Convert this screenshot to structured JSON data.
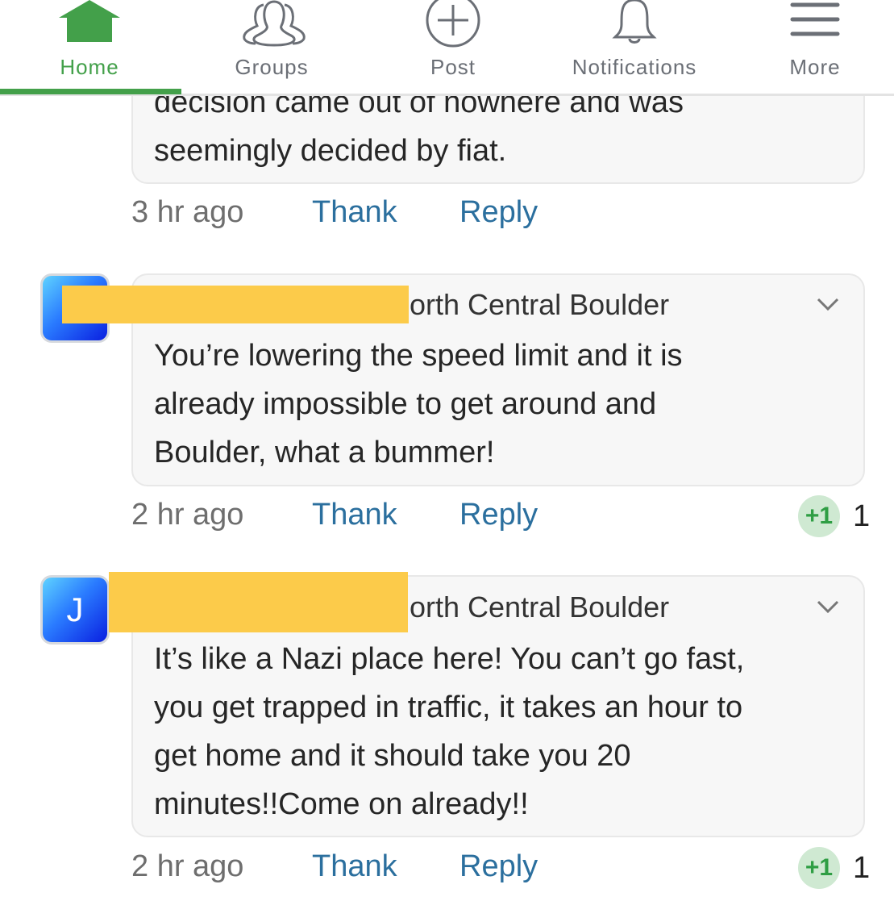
{
  "nav": {
    "tabs": [
      {
        "label": "Home",
        "icon": "home-icon",
        "active": true
      },
      {
        "label": "Groups",
        "icon": "groups-icon"
      },
      {
        "label": "Post",
        "icon": "plus-circle-icon"
      },
      {
        "label": "Notifications",
        "icon": "bell-icon"
      },
      {
        "label": "More",
        "icon": "menu-icon"
      }
    ],
    "active_color": "#43a04a"
  },
  "comments": [
    {
      "lines": [
        "decision came out of nowhere and was",
        "seemingly decided by fiat."
      ],
      "time": "3 hr ago",
      "thank": "Thank",
      "reply": "Reply"
    },
    {
      "avatar": "",
      "name_suffix": "orth Central Boulder",
      "lines": [
        "You’re lowering the speed limit and it is",
        "already impossible to get around and",
        "Boulder, what a bummer!"
      ],
      "time": "2 hr ago",
      "thank": "Thank",
      "reply": "Reply",
      "badge": "+1",
      "count": "1"
    },
    {
      "avatar": "J",
      "name_suffix": "orth Central Boulder",
      "lines": [
        "It’s like a Nazi place here! You can’t go fast,",
        "you get trapped in traffic, it takes an hour to",
        "get home and it should take you 20",
        "minutes!!Come on already!!"
      ],
      "time": "2 hr ago",
      "thank": "Thank",
      "reply": "Reply",
      "badge": "+1",
      "count": "1"
    }
  ],
  "colors": {
    "link": "#2b6f9e",
    "redaction": "#fccb4a",
    "badge_bg": "#cfe9d2"
  }
}
